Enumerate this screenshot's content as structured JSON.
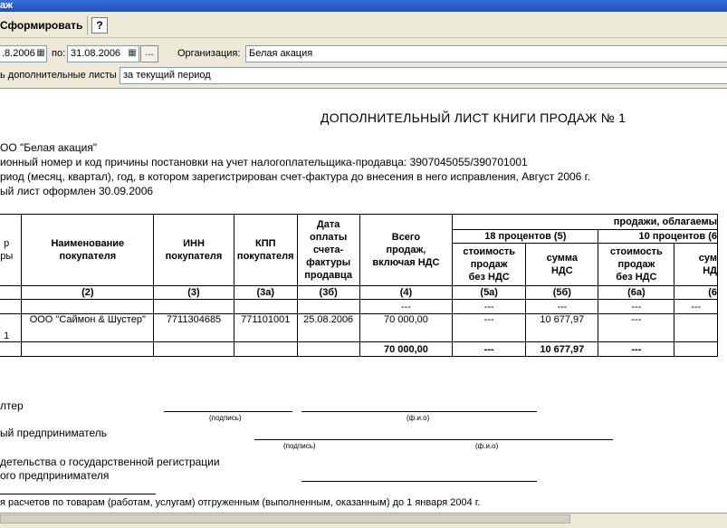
{
  "window": {
    "title": "аж"
  },
  "toolbar": {
    "generate_label": "Сформировать",
    "help_label": "?",
    "generate_icon": "generate-icon"
  },
  "params": {
    "date_from": ".8.2006",
    "to_label": "по:",
    "date_to": "31.08.2006",
    "dots_label": "...",
    "org_label": "Организация:",
    "org_value": "Белая акация",
    "sheets_label": "ь дополнительные листы",
    "sheets_value": "за текущий период"
  },
  "document": {
    "title": "ДОПОЛНИТЕЛЬНЫЙ  ЛИСТ  КНИГИ ПРОДАЖ  № 1",
    "seller_line": "ОО \"Белая акация\"",
    "inn_line": "ионный номер и код причины постановки на учет налогоплательщика-продавца:  3907045055/390701001",
    "period_line": "риод (месяц, квартал), год, в котором зарегистрирован счет-фактура до внесения в него исправления, Август 2006 г.",
    "sheet_date_line": "ый лист оформлен 30.09.2006",
    "headers": {
      "col1": "р\nры",
      "name": "Наименование\nпокупателя",
      "inn": "ИНН\nпокупателя",
      "kpp": "КПП\nпокупателя",
      "pay_date": "Дата\nоплаты\nсчета-\nфактуры\nпродавца",
      "total": "Всего\nпродаж,\nвключая НДС",
      "taxed": "продажи, облагаемы",
      "p18": "18 процентов (5)",
      "p10": "10 процентов (6",
      "cost_5a": "стоимость\nпродаж\nбез НДС",
      "vat_5b": "сумма\nНДС",
      "cost_6a": "стоимость\nпродаж\nбез НДС",
      "vat_6b": "сум\nНД"
    },
    "col_numbers": [
      "",
      "(2)",
      "(3)",
      "(3а)",
      "(3б)",
      "(4)",
      "(5а)",
      "(5б)",
      "(6а)",
      "(6"
    ],
    "dash_row": [
      "",
      "",
      "",
      "",
      "",
      "---",
      "---",
      "---",
      "---",
      "---"
    ],
    "data_row": [
      "1",
      "ООО \"Саймон & Шустер\"",
      "7711304685",
      "771101001",
      "25.08.2006",
      "70 000,00",
      "---",
      "10 677,97",
      "---",
      ""
    ],
    "total_row": {
      "total": "70 000,00",
      "c5a": "---",
      "c5b": "10 677,97",
      "c6a": "---"
    },
    "sign": {
      "accountant": "лтер",
      "podpis1": "(подпись)",
      "fio1": "(ф.и.о)",
      "entrepreneur": "ый предприниматель",
      "podpis2": "(подпись)",
      "fio2": "(ф.и.о)",
      "cert_line1": "детельства о государственной регистрации",
      "cert_line2": "ого предпринимателя"
    },
    "footnote": "я расчетов по товарам (работам, услугам) отгруженным (выполненным, оказанным) до 1 января 2004 г."
  }
}
